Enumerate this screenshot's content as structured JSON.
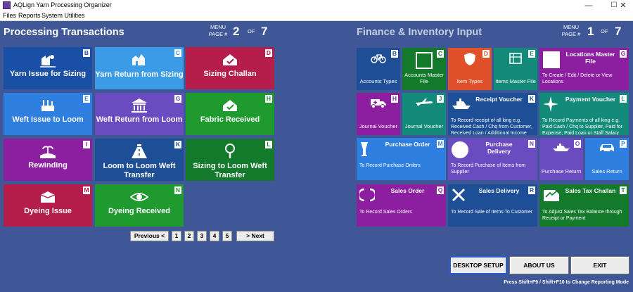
{
  "window": {
    "title": "AQLign Yarn Processing Organizer",
    "minimize": "—",
    "maximize": "☐",
    "close": "✕"
  },
  "menu": [
    "Files",
    "Reports",
    "System Utilities"
  ],
  "processing": {
    "title": "Processing Transactions",
    "menu_label": "MENU",
    "page_label": "PAGE #",
    "page": "2",
    "of_label": "OF",
    "total": "7",
    "tiles": [
      {
        "label": "Yarn Issue for Sizing",
        "key": "B",
        "color": "#1a4fa6",
        "icon": "yarn-issue-icon"
      },
      {
        "label": "Yarn Return from Sizing",
        "key": "C",
        "color": "#3c9be6",
        "icon": "factory-icon"
      },
      {
        "label": "Sizing Challan",
        "key": "D",
        "color": "#b51e4b",
        "icon": "challan-icon"
      },
      {
        "label": "Weft Issue to Loom",
        "key": "E",
        "color": "#2e7fe0",
        "icon": "loom-icon"
      },
      {
        "label": "Weft Return from Loom",
        "key": "G",
        "color": "#6a4bc0",
        "icon": "building-icon"
      },
      {
        "label": "Fabric Received",
        "key": "H",
        "color": "#1f9a2f",
        "icon": "fabric-icon"
      },
      {
        "label": "Rewinding",
        "key": "I",
        "color": "#8b1fa0",
        "icon": "island-icon"
      },
      {
        "label": "Loom to Loom Weft Transfer",
        "key": "K",
        "color": "#1d4e96",
        "icon": "road-icon"
      },
      {
        "label": "Sizing to Loom Weft Transfer",
        "key": "L",
        "color": "#137a2b",
        "icon": "magnifier-icon"
      },
      {
        "label": "Dyeing Issue",
        "key": "M",
        "color": "#b51e4b",
        "icon": "dye-box-icon"
      },
      {
        "label": "Dyeing Received",
        "key": "N",
        "color": "#1f9a2f",
        "icon": "eye-icon"
      }
    ]
  },
  "pager": {
    "prev": "Previous <",
    "pages": [
      "1",
      "2",
      "3",
      "4",
      "5"
    ],
    "next": "> Next"
  },
  "finance": {
    "title": "Finance & Inventory Input",
    "menu_label": "MENU",
    "page_label": "PAGE #",
    "page": "1",
    "of_label": "OF",
    "total": "7",
    "small_tiles": {
      "accounts_types": {
        "label": "Accounts Types",
        "key": "B",
        "color": "#1d4e96"
      },
      "accounts_master": {
        "label": "Accounts Master File",
        "key": "C",
        "color": "#137a2b"
      },
      "item_types": {
        "label": "Item Types",
        "key": "D",
        "color": "#e0502a"
      },
      "items_master": {
        "label": "Items Master File",
        "key": "E",
        "color": "#138a7a"
      },
      "journal_voucher_h": {
        "label": "Journal Voucher",
        "key": "H",
        "color": "#8b1fa0"
      },
      "journal_voucher_j": {
        "label": "Journal Voucher",
        "key": "J",
        "color": "#138a7a"
      },
      "purchase_return": {
        "label": "Purchase Return",
        "key": "O",
        "color": "#6a4bc0"
      },
      "sales_return": {
        "label": "Sales Return",
        "key": "P",
        "color": "#2e7fe0"
      }
    },
    "wide_tiles": {
      "locations_master": {
        "title": "Locations Master File",
        "desc": "To Create / Edit / Delete or View Locations",
        "key": "G",
        "color": "#8b1fa0"
      },
      "receipt_voucher": {
        "title": "Receipt Voucher",
        "desc": "To Record receipt of all king e.g. Received Cash / Chq from Customer, Received Loan / Additional Income",
        "key": "K",
        "color": "#1d4e96"
      },
      "payment_voucher": {
        "title": "Payment Voucher",
        "desc": "To Record Payments of all king e.g. Paid Cash / Chq to Supplier, Paid for Expense, Paid Loan or Staff Salary",
        "key": "L",
        "color": "#138a7a"
      },
      "purchase_order": {
        "title": "Purchase Order",
        "desc": "To Record Purchase Orders",
        "key": "M",
        "color": "#2e7fe0"
      },
      "purchase_delivery": {
        "title": "Purchase Delivery",
        "desc": "To Record Purchase of Items from Supplier",
        "key": "N",
        "color": "#6a4bc0"
      },
      "sales_order": {
        "title": "Sales Order",
        "desc": "To Record Sales Orders",
        "key": "Q",
        "color": "#8b1fa0"
      },
      "sales_delivery": {
        "title": "Sales Delivery",
        "desc": "To Record Sale of Items To Customer",
        "key": "R",
        "color": "#1d4e96"
      },
      "sales_tax_challan": {
        "title": "Sales Tax Challan",
        "desc": "To Adjust Sales Tax Balance through Receipt or Payment",
        "key": "T",
        "color": "#137a2b"
      }
    }
  },
  "buttons": {
    "desktop_setup": "DESKTOP SETUP",
    "about_us": "ABOUT US",
    "exit": "EXIT"
  },
  "hint": "Press Shift+F9 / Shift+F10 to Change Reporting Mode"
}
